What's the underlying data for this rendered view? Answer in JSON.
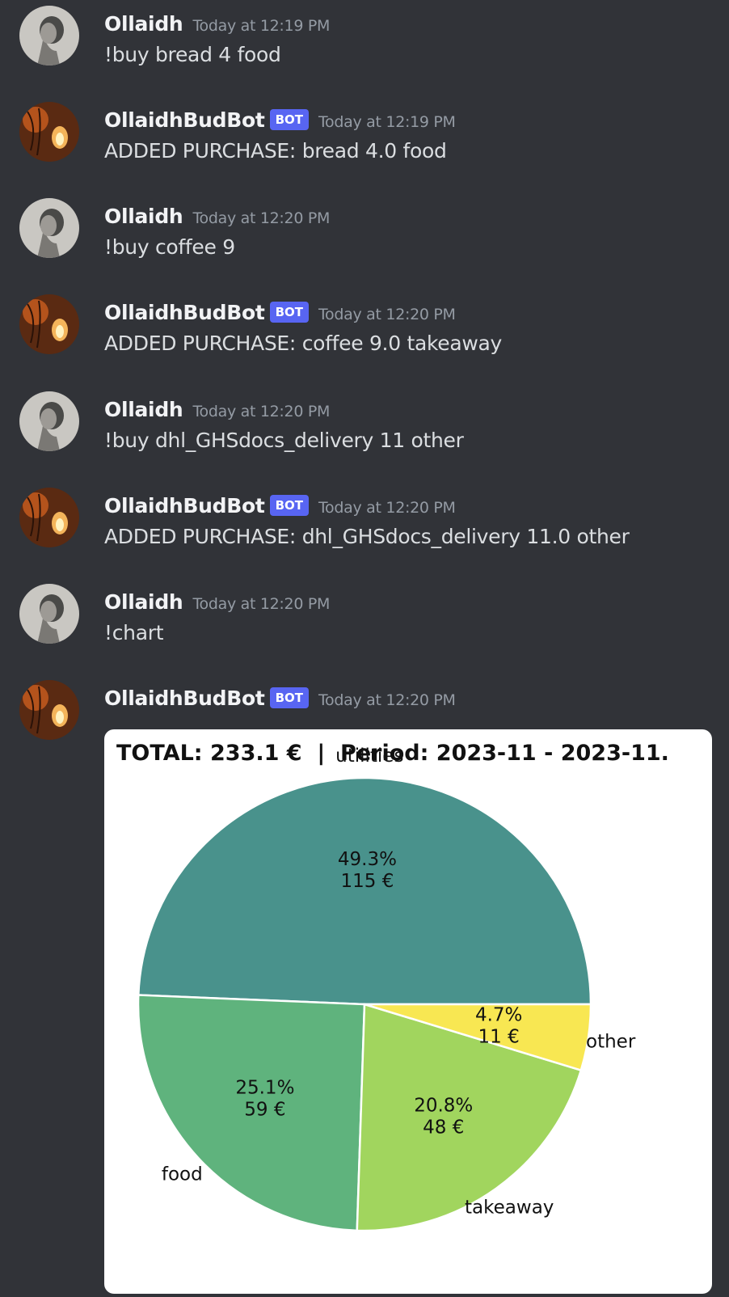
{
  "messages": [
    {
      "author": "Ollaidh",
      "timestamp": "Today at 12:19 PM",
      "content": "!buy bread 4 food",
      "is_bot": false
    },
    {
      "author": "OllaidhBudBot",
      "badge": "BOT",
      "timestamp": "Today at 12:19 PM",
      "content": "ADDED PURCHASE: bread 4.0 food",
      "is_bot": true
    },
    {
      "author": "Ollaidh",
      "timestamp": "Today at 12:20 PM",
      "content": "!buy coffee 9",
      "is_bot": false
    },
    {
      "author": "OllaidhBudBot",
      "badge": "BOT",
      "timestamp": "Today at 12:20 PM",
      "content": "ADDED PURCHASE: coffee 9.0 takeaway",
      "is_bot": true
    },
    {
      "author": "Ollaidh",
      "timestamp": "Today at 12:20 PM",
      "content": "!buy dhl_GHSdocs_delivery 11 other",
      "is_bot": false
    },
    {
      "author": "OllaidhBudBot",
      "badge": "BOT",
      "timestamp": "Today at 12:20 PM",
      "content": "ADDED PURCHASE: dhl_GHSdocs_delivery 11.0 other",
      "is_bot": true
    },
    {
      "author": "Ollaidh",
      "timestamp": "Today at 12:20 PM",
      "content": "!chart",
      "is_bot": false
    },
    {
      "author": "OllaidhBudBot",
      "badge": "BOT",
      "timestamp": "Today at 12:20 PM",
      "content": "",
      "is_bot": true
    }
  ],
  "colors": {
    "background": "#313338",
    "badge": "#5865f2",
    "username": "#f2f3f5",
    "text": "#dbdee1",
    "timestamp": "#949ba4"
  },
  "chart_data": {
    "type": "pie",
    "title": "TOTAL: 233.1 €  |  Period: 2023-11 - 2023-11.",
    "slices": [
      {
        "label": "utilities",
        "percent": 49.3,
        "value_label": "115 €",
        "color": "#49928c"
      },
      {
        "label": "food",
        "percent": 25.1,
        "value_label": "59 €",
        "color": "#5fb37d"
      },
      {
        "label": "takeaway",
        "percent": 20.8,
        "value_label": "48 €",
        "color": "#a1d55e"
      },
      {
        "label": "other",
        "percent": 4.7,
        "value_label": "11 €",
        "color": "#f8e752"
      }
    ],
    "start_angle": 0,
    "direction": "counterclockwise"
  }
}
